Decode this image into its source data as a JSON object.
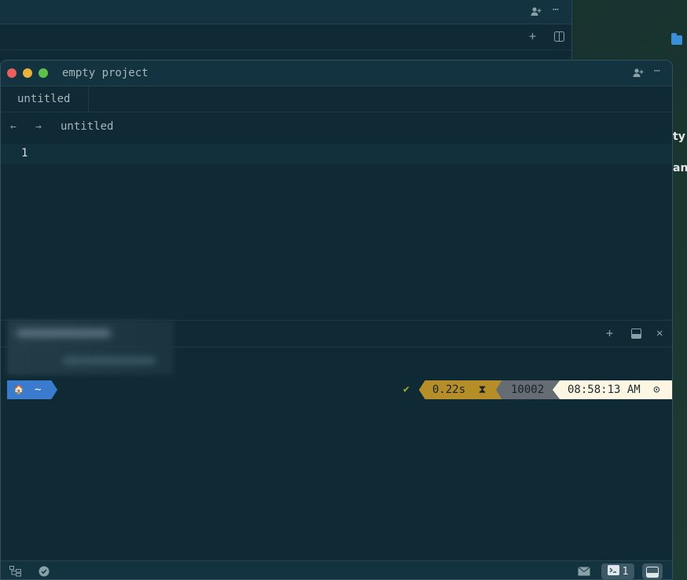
{
  "desktop": {
    "label_1": "ty",
    "label_2": "an"
  },
  "window": {
    "title": "empty project",
    "tab": "untitled",
    "breadcrumb": "untitled",
    "line_number": "1"
  },
  "icons": {
    "add_collaborator": "person-plus-icon",
    "more": "ellipsis-icon",
    "new": "plus-icon",
    "split": "split-pane-icon",
    "back": "arrow-left-icon",
    "forward": "arrow-right-icon",
    "maximize": "maximize-icon",
    "close": "close-icon",
    "tree": "project-tree-icon",
    "diagnostics": "check-circle-icon",
    "mail": "mail-icon",
    "terminal": "terminal-icon",
    "panel": "panel-icon"
  },
  "terminal": {
    "prompt_home_icon": "🏠",
    "prompt_path": "~",
    "status_ok": "✔",
    "duration": "0.22s",
    "hourglass": "⧗",
    "exit_code": "10002",
    "clock": "08:58:13 AM",
    "clock_icon": "⊙"
  },
  "statusbar": {
    "terminal_count": "1"
  },
  "colors": {
    "editor_bg": "#0f2a35",
    "titlebar_bg": "#133341",
    "prompt_home": "#3a7bd0",
    "prompt_duration": "#b58e2a",
    "prompt_exit": "#656c73",
    "prompt_clock": "#fdf6e3",
    "traffic_close": "#ec5f5a",
    "traffic_minimize": "#e9b33b",
    "traffic_zoom": "#5ec34c"
  }
}
